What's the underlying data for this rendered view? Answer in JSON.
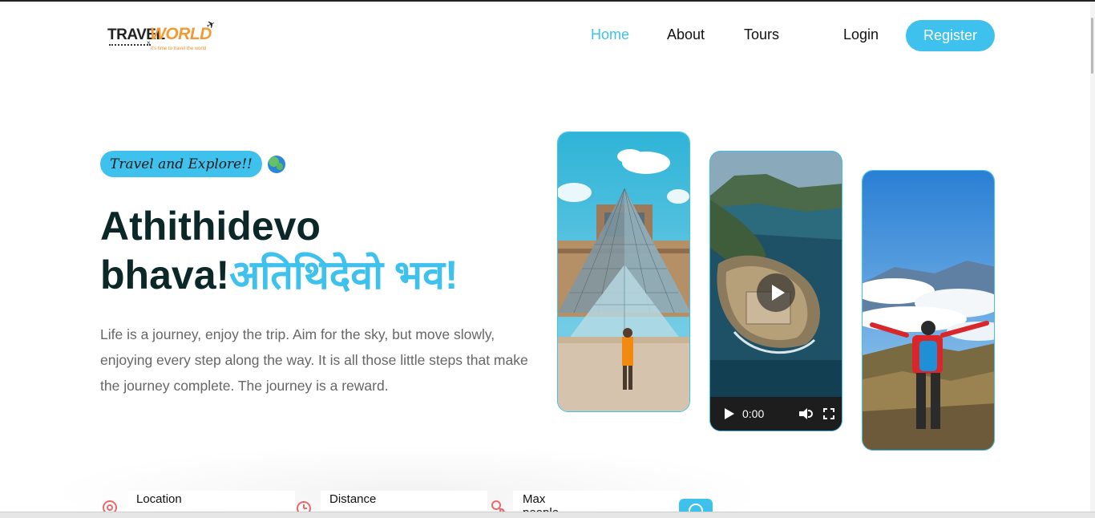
{
  "brand": {
    "word1": "TRAVEL",
    "word2": "WORLD",
    "tagline": "it's time to travel the world"
  },
  "nav": {
    "items": [
      "Home",
      "About",
      "Tours"
    ],
    "active": "Home",
    "login_label": "Login",
    "register_label": "Register"
  },
  "hero": {
    "subtitle": "Travel and Explore!!",
    "title_line1": "Athithidevo",
    "title_line2_prefix": "bhava!",
    "title_highlight": "अतिथिदेवो भव!",
    "description": "Life is a journey, enjoy the trip. Aim for the sky, but move slowly, enjoying every step along the way. It is all those little steps that make the journey complete. The journey is a reward."
  },
  "video": {
    "time": "0:00"
  },
  "search": {
    "fields": [
      {
        "label": "Location",
        "icon": "location-icon"
      },
      {
        "label": "Distance",
        "icon": "clock-icon"
      },
      {
        "label": "Max people",
        "icon": "people-icon"
      }
    ]
  },
  "colors": {
    "accent": "#3ec1ec",
    "heading": "#0b2727",
    "logo_orange": "#f29a36",
    "icon_red": "#e86a6a"
  }
}
